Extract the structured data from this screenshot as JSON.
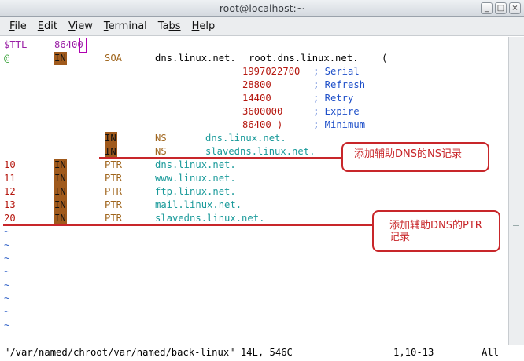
{
  "window": {
    "title": "root@localhost:~",
    "buttons": [
      "_",
      "□",
      "×"
    ]
  },
  "menubar": [
    {
      "label": "File",
      "accel": "F",
      "rest": "ile"
    },
    {
      "label": "Edit",
      "accel": "E",
      "rest": "dit"
    },
    {
      "label": "View",
      "accel": "V",
      "rest": "iew"
    },
    {
      "label": "Terminal",
      "accel": "T",
      "rest": "erminal"
    },
    {
      "label": "Tabs",
      "accel": "Ta",
      "rest": "bs",
      "pre": "",
      "underline_index": 2
    },
    {
      "label": "Help",
      "accel": "H",
      "rest": "elp"
    }
  ],
  "editor": {
    "ttl_key": "$TTL",
    "ttl_value": "86400",
    "soa": {
      "origin": "@",
      "class": "IN",
      "type": "SOA",
      "primary": "dns.linux.net.",
      "contact": "root.dns.linux.net.",
      "open_paren": "(",
      "serial": "1997022700",
      "serial_comment": "; Serial",
      "refresh": "28800",
      "refresh_comment": "; Refresh",
      "retry": "14400",
      "retry_comment": "; Retry",
      "expire": "3600000",
      "expire_comment": "; Expire",
      "minimum": "86400 )",
      "minimum_comment": "; Minimum"
    },
    "ns_records": [
      {
        "class": "IN",
        "type": "NS",
        "host": "dns.linux.net."
      },
      {
        "class": "IN",
        "type": "NS",
        "host": "slavedns.linux.net."
      }
    ],
    "ptr_records": [
      {
        "num": "10",
        "class": "IN",
        "type": "PTR",
        "host": "dns.linux.net."
      },
      {
        "num": "11",
        "class": "IN",
        "type": "PTR",
        "host": "www.linux.net."
      },
      {
        "num": "12",
        "class": "IN",
        "type": "PTR",
        "host": "ftp.linux.net."
      },
      {
        "num": "13",
        "class": "IN",
        "type": "PTR",
        "host": "mail.linux.net."
      },
      {
        "num": "20",
        "class": "IN",
        "type": "PTR",
        "host": "slavedns.linux.net."
      }
    ],
    "tilde": "~",
    "tilde_count": 8
  },
  "statusline": {
    "file": "\"/var/named/chroot/var/named/back-linux\" 14L, 546C",
    "position": "1,10-13",
    "scroll": "All"
  },
  "annotations": {
    "ns_note": "添加辅助DNS的NS记录",
    "ptr_note_line1": "添加辅助DNS的PTR",
    "ptr_note_line2": "记录"
  }
}
